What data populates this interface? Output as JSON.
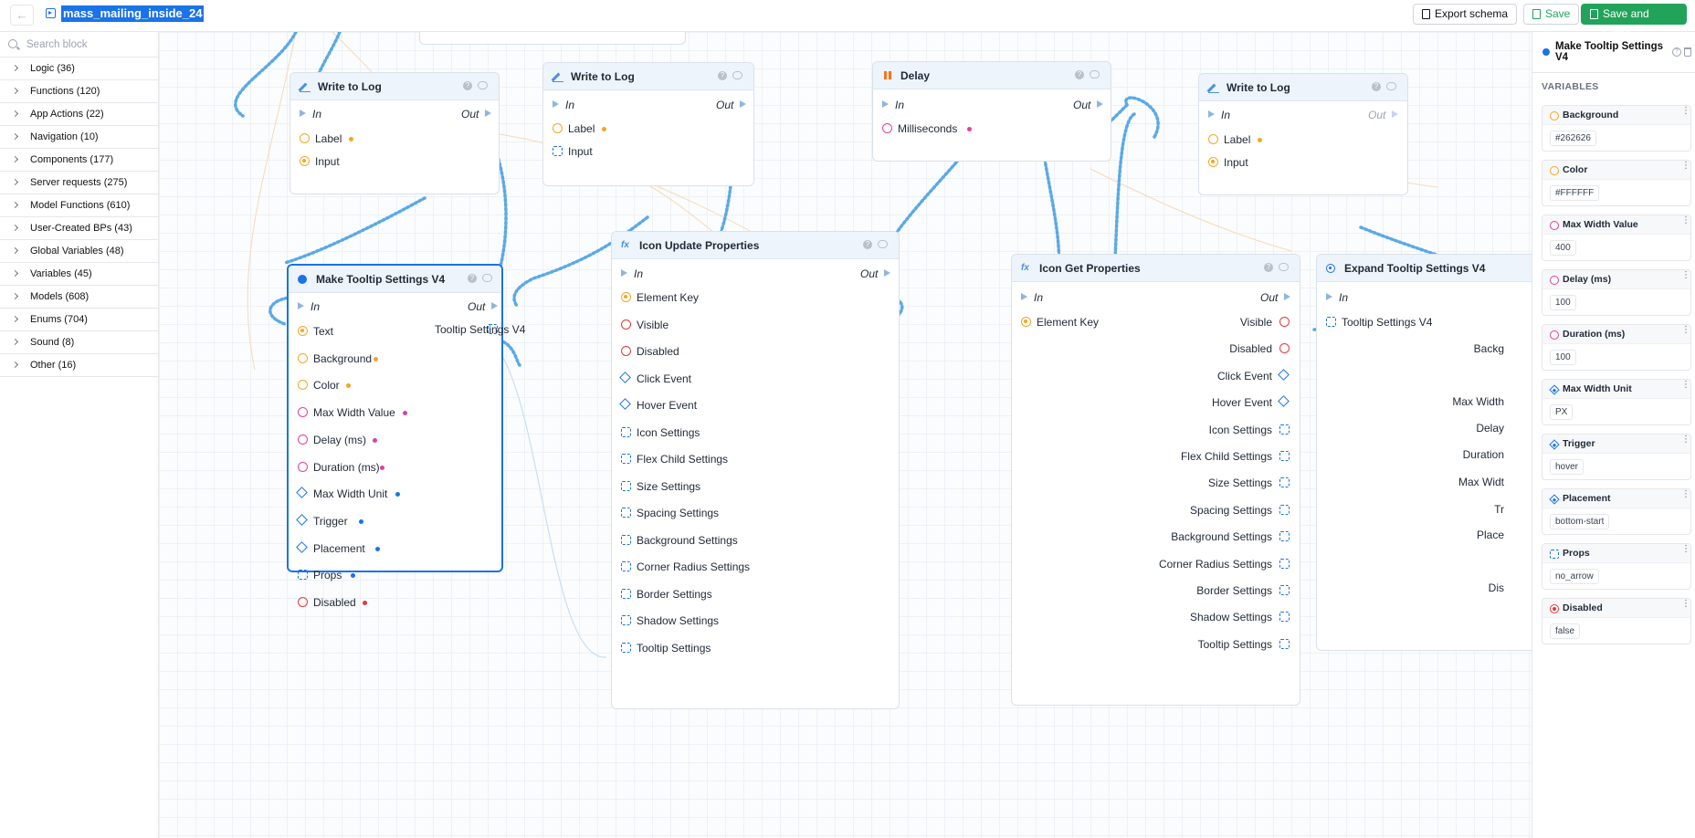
{
  "header": {
    "back_symbol": "←",
    "title": "mass_mailing_inside_24",
    "export_label": "Export schema",
    "save_label": "Save",
    "save_close_label": "Save and Close"
  },
  "sidebar": {
    "search_placeholder": "Search block",
    "categories": [
      "Logic (36)",
      "Functions (120)",
      "App Actions (22)",
      "Navigation (10)",
      "Components (177)",
      "Server requests (275)",
      "Model Functions (610)",
      "User-Created BPs (43)",
      "Global Variables (48)",
      "Variables (45)",
      "Models (608)",
      "Enums (704)",
      "Sound (8)",
      "Other (16)"
    ]
  },
  "canvas": {
    "common": {
      "in": "In",
      "out": "Out",
      "help": "?"
    },
    "write_log_1": {
      "title": "Write to Log",
      "label": "Label",
      "input": "Input"
    },
    "write_log_2": {
      "title": "Write to Log",
      "label": "Label",
      "input": "Input"
    },
    "delay": {
      "title": "Delay",
      "milliseconds": "Milliseconds"
    },
    "write_log_3": {
      "title": "Write to Log",
      "label": "Label",
      "input": "Input"
    },
    "make_tooltip": {
      "title": "Make Tooltip Settings V4",
      "output": "Tooltip Settings V4",
      "inputs": [
        "Text",
        "Background",
        "Color",
        "Max Width Value",
        "Delay (ms)",
        "Duration (ms)",
        "Max Width Unit",
        "Trigger",
        "Placement",
        "Props",
        "Disabled"
      ]
    },
    "icon_update": {
      "title": "Icon Update Properties",
      "inputs": [
        "Element Key",
        "Visible",
        "Disabled",
        "Click Event",
        "Hover Event",
        "Icon Settings",
        "Flex Child Settings",
        "Size Settings",
        "Spacing Settings",
        "Background Settings",
        "Corner Radius Settings",
        "Border Settings",
        "Shadow Settings",
        "Tooltip Settings"
      ]
    },
    "icon_get": {
      "title": "Icon Get Properties",
      "input": "Element Key",
      "outputs": [
        "Visible",
        "Disabled",
        "Click Event",
        "Hover Event",
        "Icon Settings",
        "Flex Child Settings",
        "Size Settings",
        "Spacing Settings",
        "Background Settings",
        "Corner Radius Settings",
        "Border Settings",
        "Shadow Settings",
        "Tooltip Settings"
      ]
    },
    "expand_tooltip": {
      "title": "Expand Tooltip Settings V4",
      "input": "Tooltip Settings V4",
      "outputs_partial": [
        "Backg",
        "Max Width",
        "Delay",
        "Duration",
        "Max Widt",
        "Tr",
        "Place",
        "Dis"
      ]
    }
  },
  "right_panel": {
    "title": "Make Tooltip Settings V4",
    "help": "?",
    "section": "VARIABLES",
    "menu_symbol": "⋮",
    "variables": [
      {
        "name": "Background",
        "value": "#262626",
        "icon": "circle-orange"
      },
      {
        "name": "Color",
        "value": "#FFFFFF",
        "icon": "circle-orange"
      },
      {
        "name": "Max Width Value",
        "value": "400",
        "icon": "circle-pink"
      },
      {
        "name": "Delay (ms)",
        "value": "100",
        "icon": "circle-pink"
      },
      {
        "name": "Duration (ms)",
        "value": "100",
        "icon": "circle-pink"
      },
      {
        "name": "Max Width Unit",
        "value": "PX",
        "icon": "diamond-blue"
      },
      {
        "name": "Trigger",
        "value": "hover",
        "icon": "diamond-blue"
      },
      {
        "name": "Placement",
        "value": "bottom-start",
        "icon": "diamond-blue"
      },
      {
        "name": "Props",
        "value": "no_arrow",
        "icon": "struct-blue"
      },
      {
        "name": "Disabled",
        "value": "false",
        "icon": "circle-red"
      }
    ]
  },
  "colors": {
    "accent": "#1a73e8",
    "save_green": "#22a35a",
    "wire_blue": "#5aa9e6",
    "pin_orange": "#f5a623",
    "pin_pink": "#e040a0",
    "pin_red": "#e53935"
  }
}
